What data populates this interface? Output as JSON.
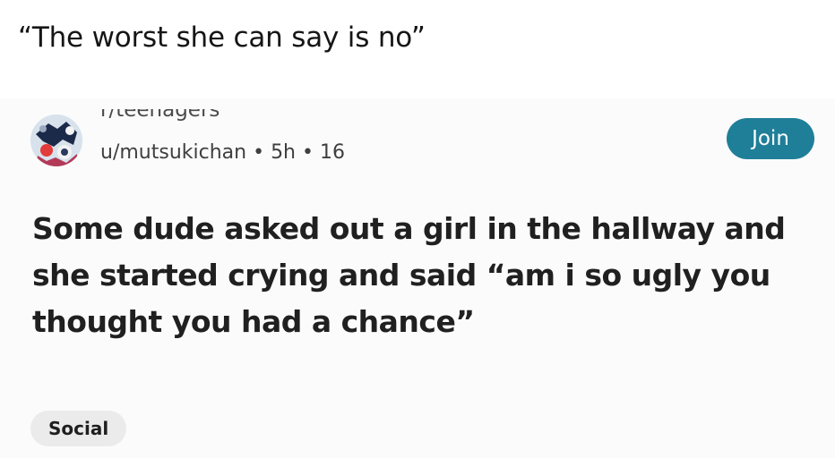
{
  "caption": "“The worst she can say is no”",
  "post": {
    "subreddit": "r/teenagers",
    "author": "u/mutsukichan",
    "age": "5h",
    "score": "16",
    "separator": "•",
    "join_label": "Join",
    "title": "Some dude asked out a girl in the hallway and she started crying and said “am i so ugly you thought you had a chance”",
    "flair": "Social"
  },
  "colors": {
    "join_button": "#1f7f98",
    "flair_background": "#ebebeb"
  }
}
